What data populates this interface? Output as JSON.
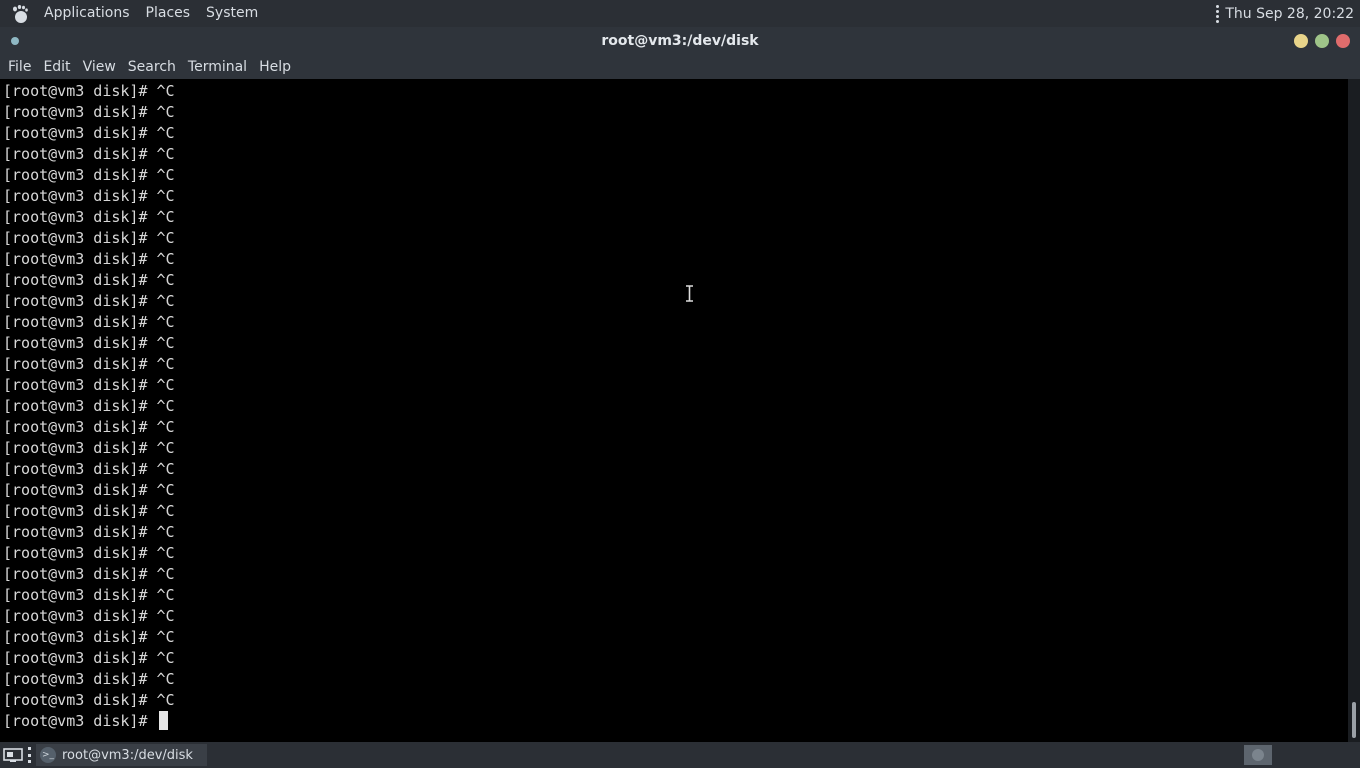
{
  "top_panel": {
    "menus": [
      "Applications",
      "Places",
      "System"
    ],
    "clock": "Thu Sep 28, 20:22"
  },
  "window": {
    "title": "root@vm3:/dev/disk"
  },
  "menubar": {
    "items": [
      "File",
      "Edit",
      "View",
      "Search",
      "Terminal",
      "Help"
    ]
  },
  "terminal": {
    "lines": [
      "[root@vm3 disk]# ^C",
      "[root@vm3 disk]# ^C",
      "[root@vm3 disk]# ^C",
      "[root@vm3 disk]# ^C",
      "[root@vm3 disk]# ^C",
      "[root@vm3 disk]# ^C",
      "[root@vm3 disk]# ^C",
      "[root@vm3 disk]# ^C",
      "[root@vm3 disk]# ^C",
      "[root@vm3 disk]# ^C",
      "[root@vm3 disk]# ^C",
      "[root@vm3 disk]# ^C",
      "[root@vm3 disk]# ^C",
      "[root@vm3 disk]# ^C",
      "[root@vm3 disk]# ^C",
      "[root@vm3 disk]# ^C",
      "[root@vm3 disk]# ^C",
      "[root@vm3 disk]# ^C",
      "[root@vm3 disk]# ^C",
      "[root@vm3 disk]# ^C",
      "[root@vm3 disk]# ^C",
      "[root@vm3 disk]# ^C",
      "[root@vm3 disk]# ^C",
      "[root@vm3 disk]# ^C",
      "[root@vm3 disk]# ^C",
      "[root@vm3 disk]# ^C",
      "[root@vm3 disk]# ^C",
      "[root@vm3 disk]# ^C",
      "[root@vm3 disk]# ^C",
      "[root@vm3 disk]# ^C"
    ],
    "prompt": "[root@vm3 disk]# "
  },
  "taskbar": {
    "task_label": "root@vm3:/dev/disk"
  },
  "colors": {
    "panel_bg": "#2b2f35",
    "titlebar_bg": "#2f343b",
    "terminal_bg": "#000000",
    "terminal_fg": "#d8d8d8",
    "close_button": "#e06c6c",
    "maximize_button": "#9fc489",
    "minimize_button": "#e8d48a"
  },
  "icons": {
    "app_menu": "gnome-foot-icon",
    "task": "terminal-icon",
    "show_desktop": "show-desktop-icon"
  }
}
